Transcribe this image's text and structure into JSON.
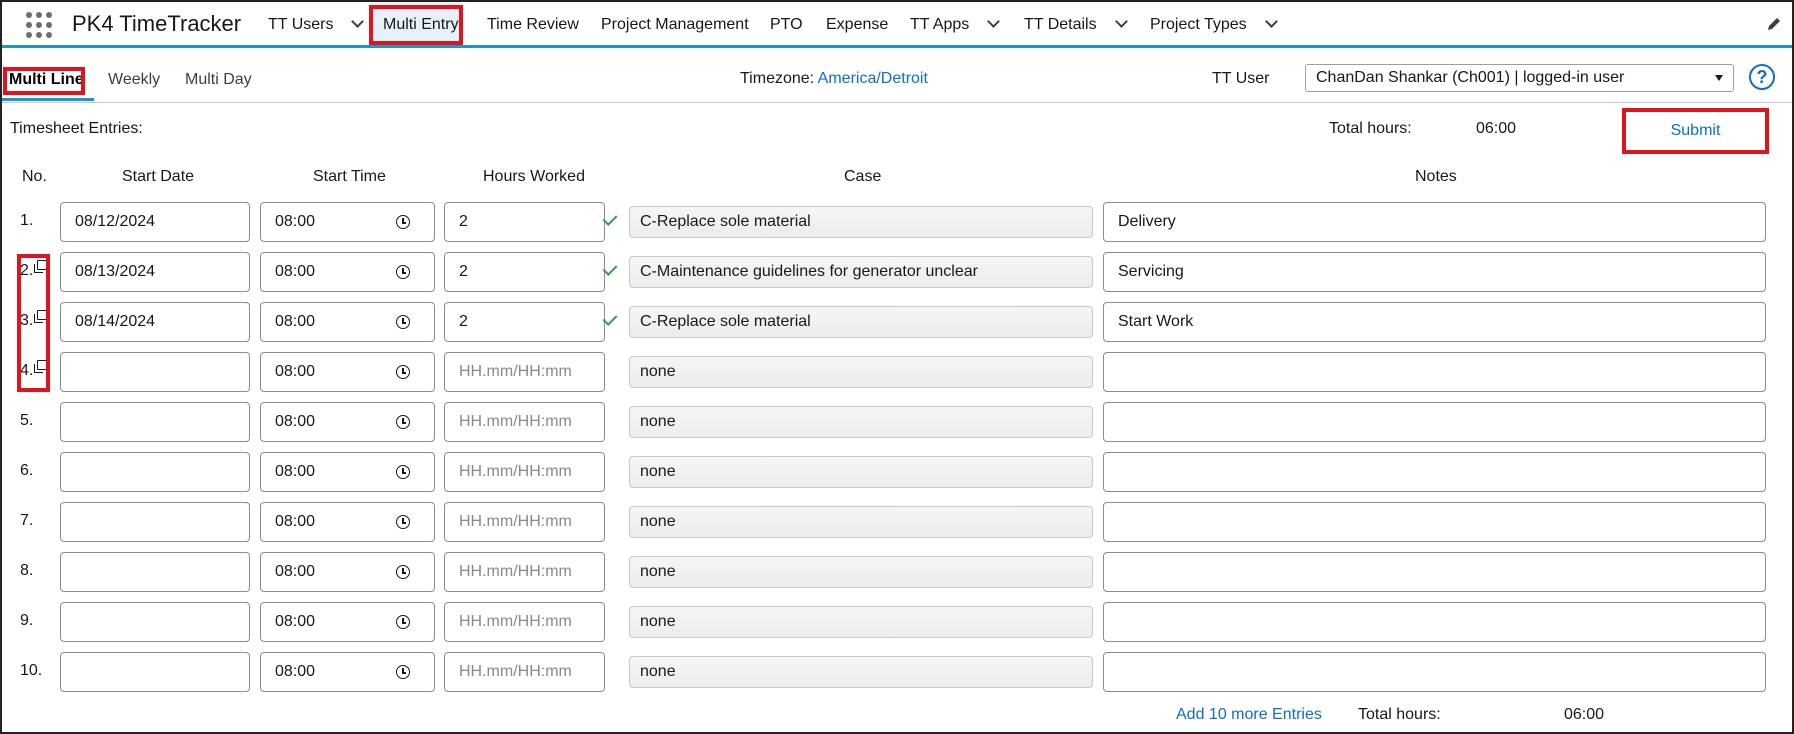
{
  "app": {
    "name": "PK4 TimeTracker"
  },
  "nav": {
    "items": [
      {
        "label": "TT Users",
        "has_menu": true
      },
      {
        "label": "Multi Entry",
        "has_menu": false,
        "active": true
      },
      {
        "label": "Time Review",
        "has_menu": false
      },
      {
        "label": "Project Management",
        "has_menu": false
      },
      {
        "label": "PTO",
        "has_menu": false
      },
      {
        "label": "Expense",
        "has_menu": false
      },
      {
        "label": "TT Apps",
        "has_menu": true
      },
      {
        "label": "TT Details",
        "has_menu": true
      },
      {
        "label": "Project Types",
        "has_menu": true
      }
    ]
  },
  "subtabs": {
    "items": [
      {
        "label": "Multi Line",
        "active": true
      },
      {
        "label": "Weekly"
      },
      {
        "label": "Multi Day"
      }
    ]
  },
  "timezone": {
    "label": "Timezone:",
    "value": "America/Detroit"
  },
  "tt_user": {
    "label": "TT User",
    "selected": "ChanDan Shankar (Ch001) | logged-in user"
  },
  "timesheet": {
    "label": "Timesheet Entries:",
    "total_label": "Total hours:",
    "total_value": "06:00",
    "submit_label": "Submit"
  },
  "columns": {
    "no": "No.",
    "start_date": "Start Date",
    "start_time": "Start Time",
    "hours_worked": "Hours Worked",
    "case": "Case",
    "notes": "Notes"
  },
  "hours_placeholder": "HH.mm/HH:mm",
  "rows": [
    {
      "no": "1.",
      "copy": false,
      "date": "08/12/2024",
      "time": "08:00",
      "hours": "2",
      "valid": true,
      "case": "C-Replace sole material",
      "notes": "Delivery"
    },
    {
      "no": "2.",
      "copy": true,
      "date": "08/13/2024",
      "time": "08:00",
      "hours": "2",
      "valid": true,
      "case": "C-Maintenance guidelines for generator unclear",
      "notes": "Servicing"
    },
    {
      "no": "3.",
      "copy": true,
      "date": "08/14/2024",
      "time": "08:00",
      "hours": "2",
      "valid": true,
      "case": "C-Replace sole material",
      "notes": "Start Work"
    },
    {
      "no": "4.",
      "copy": true,
      "date": "",
      "time": "08:00",
      "hours": "",
      "valid": false,
      "case": "none",
      "notes": ""
    },
    {
      "no": "5.",
      "copy": false,
      "date": "",
      "time": "08:00",
      "hours": "",
      "valid": false,
      "case": "none",
      "notes": ""
    },
    {
      "no": "6.",
      "copy": false,
      "date": "",
      "time": "08:00",
      "hours": "",
      "valid": false,
      "case": "none",
      "notes": ""
    },
    {
      "no": "7.",
      "copy": false,
      "date": "",
      "time": "08:00",
      "hours": "",
      "valid": false,
      "case": "none",
      "notes": ""
    },
    {
      "no": "8.",
      "copy": false,
      "date": "",
      "time": "08:00",
      "hours": "",
      "valid": false,
      "case": "none",
      "notes": ""
    },
    {
      "no": "9.",
      "copy": false,
      "date": "",
      "time": "08:00",
      "hours": "",
      "valid": false,
      "case": "none",
      "notes": ""
    },
    {
      "no": "10.",
      "copy": false,
      "date": "",
      "time": "08:00",
      "hours": "",
      "valid": false,
      "case": "none",
      "notes": ""
    }
  ],
  "footer": {
    "add_more": "Add 10 more Entries",
    "total_label": "Total hours:",
    "total_value": "06:00"
  },
  "colors": {
    "accent": "#1b96c8",
    "link": "#0b6fcc",
    "highlight": "#e0141e",
    "valid": "#2e9e49"
  }
}
